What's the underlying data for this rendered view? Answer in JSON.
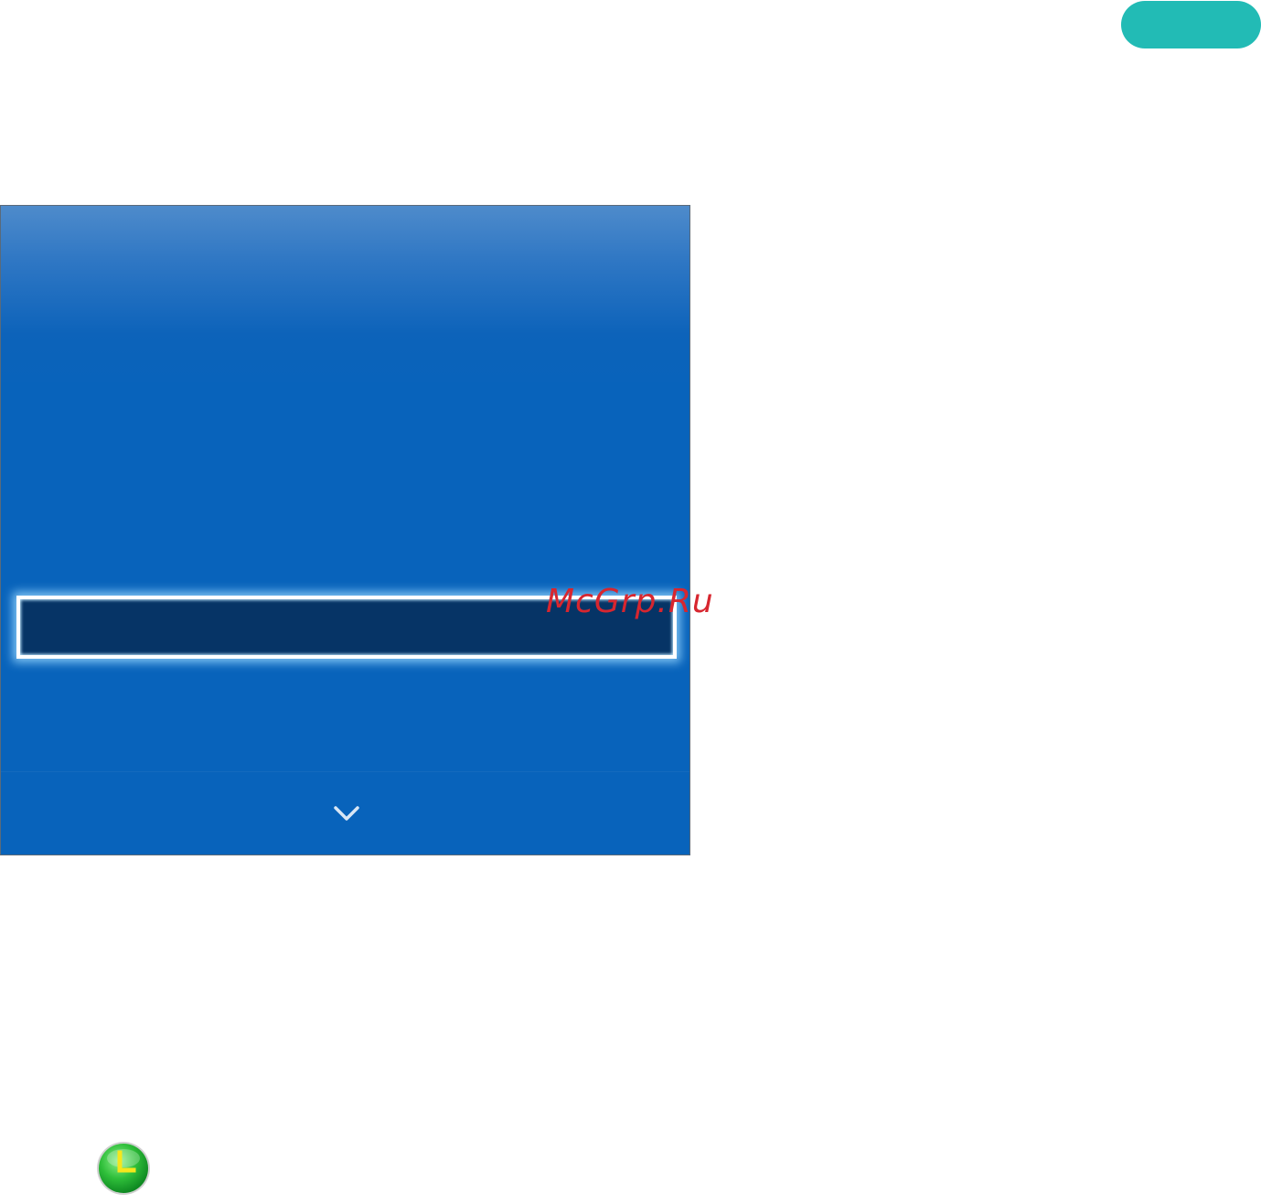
{
  "top_badge": {
    "color": "#22bbb5",
    "icon": "pill-badge"
  },
  "tv_panel": {
    "background_color": "#0863bb",
    "focused_row_color": "#063466",
    "scroll_icon": "chevron-down-icon"
  },
  "watermark": {
    "text": "McGrp.Ru",
    "color": "#d7262f"
  },
  "footer": {
    "icon": "clock-icon",
    "icon_color": "#3cc23c"
  }
}
